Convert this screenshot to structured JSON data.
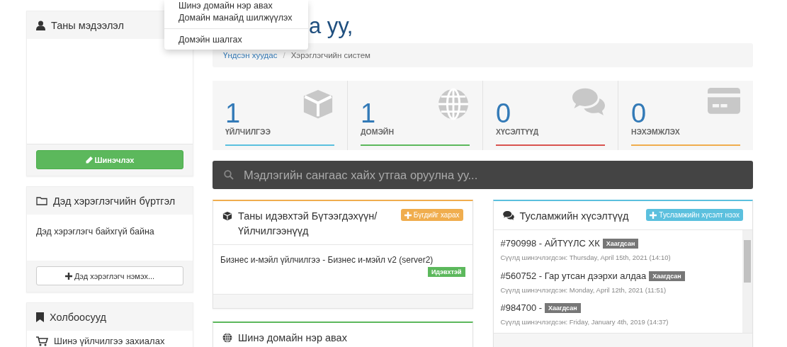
{
  "dropdown_menu": {
    "items": [
      {
        "label": "Шинэ домайн нэр авах",
        "divider_before": false
      },
      {
        "label": "Домайн манайд шилжүүлэх",
        "divider_before": false
      },
      {
        "label": "Домэйн шалгах",
        "divider_before": true
      }
    ]
  },
  "page_heading": "а уу,",
  "breadcrumb": {
    "separator": "/",
    "items": [
      {
        "label": "Үндсэн хуудас",
        "link": true
      },
      {
        "label": "Хэрэглэгчийн систем",
        "link": false
      }
    ]
  },
  "sidebar": {
    "panels": [
      {
        "kind": "profile",
        "title": "Таны мэдээлэл",
        "button": {
          "label": "Шинэчлэх",
          "kind": "success"
        }
      },
      {
        "kind": "contacts",
        "title": "Дэд хэрэглэгчийн бүртгэл",
        "text": "Дэд хэрэглэгч байхгүй байна",
        "button": {
          "label": "Дэд хэрэглэгч нэмэх...",
          "kind": "default"
        }
      },
      {
        "kind": "links",
        "title": "Холбоосууд",
        "items": [
          "Шинэ үйлчилгээ захиалах"
        ]
      }
    ]
  },
  "stats": [
    {
      "kind": "services",
      "value": "1",
      "label": "ҮЙЛЧИЛГЭЭ",
      "color": "#5bc0de"
    },
    {
      "kind": "domains",
      "value": "1",
      "label": "ДОМЭЙН",
      "color": "#5cb85c"
    },
    {
      "kind": "tickets",
      "value": "0",
      "label": "ХҮСЭЛТҮҮД",
      "color": "#d9534f"
    },
    {
      "kind": "invoices",
      "value": "0",
      "label": "НЭХЭМЖЛЭХ",
      "color": "#f0ad4e"
    }
  ],
  "search": {
    "placeholder": "Мэдлэгийн сангаас хайх утгаа оруулна уу..."
  },
  "products_panel": {
    "title": "Таны идэвхтэй Бүтээгдэхүүн/ Үйлчилгээнүүд",
    "button": "Бүгдийг харах",
    "items": [
      {
        "name": "Бизнес и-мэйл үйлчилгээ - Бизнес и-мэйл v2 (server2)",
        "status": "Идэвхтэй"
      }
    ]
  },
  "domain_panel": {
    "title": "Шинэ домайн нэр авах"
  },
  "tickets_panel": {
    "title": "Тусламжийн хүсэлтүүд",
    "button": "Тусламжийн хүсэлт нээх",
    "tickets": [
      {
        "title": "#790998 - АЙТҮҮЛС ХК",
        "status": "Хаагдсан",
        "updated": "Сүүлд шинэчлэгдсэн: Thursday, April 15th, 2021 (14:10)"
      },
      {
        "title": "#560752 - Гар утсан дээрхи алдаа",
        "status": "Хаагдсан",
        "updated": "Сүүлд шинэчлэгдсэн: Monday, April 12th, 2021 (11:51)"
      },
      {
        "title": "#984700 -",
        "status": "Хаагдсан",
        "updated": "Сүүлд шинэчлэгдсэн: Friday, January 4th, 2019 (14:37)"
      }
    ]
  }
}
